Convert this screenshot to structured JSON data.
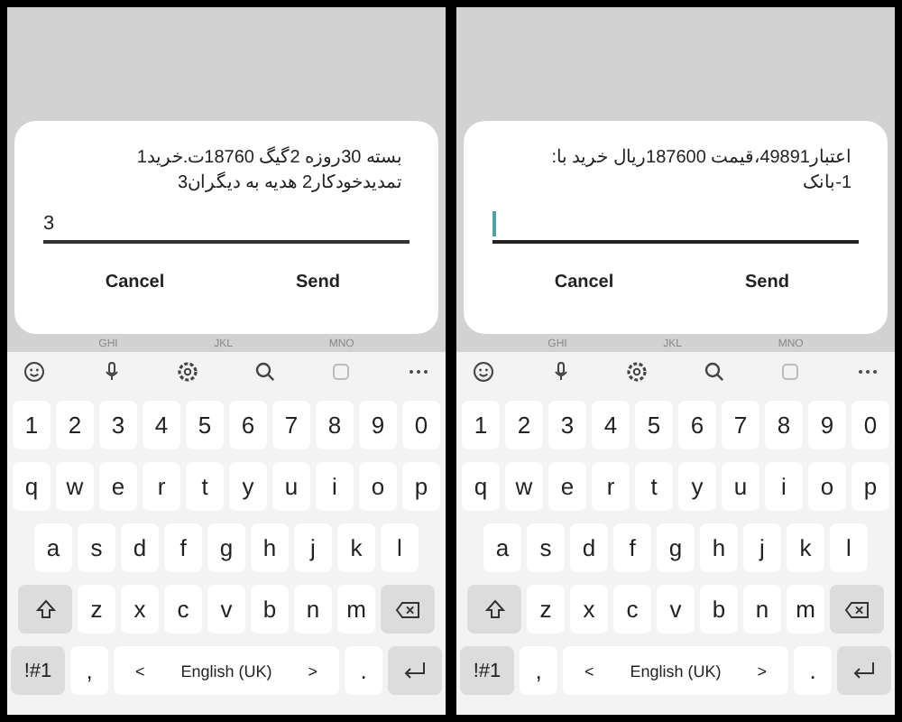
{
  "panels": [
    {
      "dialog": {
        "message": "بسته 30روزه 2گیگ 18760ت.خرید1 تمدیدخودکار2 هدیه به دیگران3",
        "value": "3",
        "focused": false,
        "buttons": [
          "Cancel",
          "Send"
        ]
      },
      "hints": [
        "GHI",
        "JKL",
        "MNO"
      ],
      "keyboard": {
        "rows": [
          [
            {
              "kind": "char",
              "label": "1"
            },
            {
              "kind": "char",
              "label": "2"
            },
            {
              "kind": "char",
              "label": "3"
            },
            {
              "kind": "char",
              "label": "4"
            },
            {
              "kind": "char",
              "label": "5"
            },
            {
              "kind": "char",
              "label": "6"
            },
            {
              "kind": "char",
              "label": "7"
            },
            {
              "kind": "char",
              "label": "8"
            },
            {
              "kind": "char",
              "label": "9"
            },
            {
              "kind": "char",
              "label": "0"
            }
          ],
          [
            {
              "kind": "char",
              "label": "q"
            },
            {
              "kind": "char",
              "label": "w"
            },
            {
              "kind": "char",
              "label": "e"
            },
            {
              "kind": "char",
              "label": "r"
            },
            {
              "kind": "char",
              "label": "t"
            },
            {
              "kind": "char",
              "label": "y"
            },
            {
              "kind": "char",
              "label": "u"
            },
            {
              "kind": "char",
              "label": "i"
            },
            {
              "kind": "char",
              "label": "o"
            },
            {
              "kind": "char",
              "label": "p"
            }
          ],
          [
            {
              "kind": "char",
              "label": "a"
            },
            {
              "kind": "char",
              "label": "s"
            },
            {
              "kind": "char",
              "label": "d"
            },
            {
              "kind": "char",
              "label": "f"
            },
            {
              "kind": "char",
              "label": "g"
            },
            {
              "kind": "char",
              "label": "h"
            },
            {
              "kind": "char",
              "label": "j"
            },
            {
              "kind": "char",
              "label": "k"
            },
            {
              "kind": "char",
              "label": "l"
            }
          ],
          [
            {
              "kind": "shift"
            },
            {
              "kind": "char",
              "label": "z"
            },
            {
              "kind": "char",
              "label": "x"
            },
            {
              "kind": "char",
              "label": "c"
            },
            {
              "kind": "char",
              "label": "v"
            },
            {
              "kind": "char",
              "label": "b"
            },
            {
              "kind": "char",
              "label": "n"
            },
            {
              "kind": "char",
              "label": "m"
            },
            {
              "kind": "backspace"
            }
          ],
          [
            {
              "kind": "symbols",
              "label": "!#1"
            },
            {
              "kind": "char",
              "label": ","
            },
            {
              "kind": "space",
              "label": "English (UK)",
              "prev": "<",
              "next": ">"
            },
            {
              "kind": "char",
              "label": "."
            },
            {
              "kind": "enter"
            }
          ]
        ]
      }
    },
    {
      "dialog": {
        "message": "اعتبار49891،قیمت 187600ریال خرید با:\n1-بانک",
        "focused": true,
        "buttons": [
          "Cancel",
          "Send"
        ]
      },
      "hints": [
        "GHI",
        "JKL",
        "MNO"
      ],
      "keyboard": {
        "rows": [
          [
            {
              "kind": "char",
              "label": "1"
            },
            {
              "kind": "char",
              "label": "2"
            },
            {
              "kind": "char",
              "label": "3"
            },
            {
              "kind": "char",
              "label": "4"
            },
            {
              "kind": "char",
              "label": "5"
            },
            {
              "kind": "char",
              "label": "6"
            },
            {
              "kind": "char",
              "label": "7"
            },
            {
              "kind": "char",
              "label": "8"
            },
            {
              "kind": "char",
              "label": "9"
            },
            {
              "kind": "char",
              "label": "0"
            }
          ],
          [
            {
              "kind": "char",
              "label": "q"
            },
            {
              "kind": "char",
              "label": "w"
            },
            {
              "kind": "char",
              "label": "e"
            },
            {
              "kind": "char",
              "label": "r"
            },
            {
              "kind": "char",
              "label": "t"
            },
            {
              "kind": "char",
              "label": "y"
            },
            {
              "kind": "char",
              "label": "u"
            },
            {
              "kind": "char",
              "label": "i"
            },
            {
              "kind": "char",
              "label": "o"
            },
            {
              "kind": "char",
              "label": "p"
            }
          ],
          [
            {
              "kind": "char",
              "label": "a"
            },
            {
              "kind": "char",
              "label": "s"
            },
            {
              "kind": "char",
              "label": "d"
            },
            {
              "kind": "char",
              "label": "f"
            },
            {
              "kind": "char",
              "label": "g"
            },
            {
              "kind": "char",
              "label": "h"
            },
            {
              "kind": "char",
              "label": "j"
            },
            {
              "kind": "char",
              "label": "k"
            },
            {
              "kind": "char",
              "label": "l"
            }
          ],
          [
            {
              "kind": "shift"
            },
            {
              "kind": "char",
              "label": "z"
            },
            {
              "kind": "char",
              "label": "x"
            },
            {
              "kind": "char",
              "label": "c"
            },
            {
              "kind": "char",
              "label": "v"
            },
            {
              "kind": "char",
              "label": "b"
            },
            {
              "kind": "char",
              "label": "n"
            },
            {
              "kind": "char",
              "label": "m"
            },
            {
              "kind": "backspace"
            }
          ],
          [
            {
              "kind": "symbols",
              "label": "!#1"
            },
            {
              "kind": "char",
              "label": ","
            },
            {
              "kind": "space",
              "label": "English (UK)",
              "prev": "<",
              "next": ">"
            },
            {
              "kind": "char",
              "label": "."
            },
            {
              "kind": "enter"
            }
          ]
        ]
      }
    }
  ]
}
